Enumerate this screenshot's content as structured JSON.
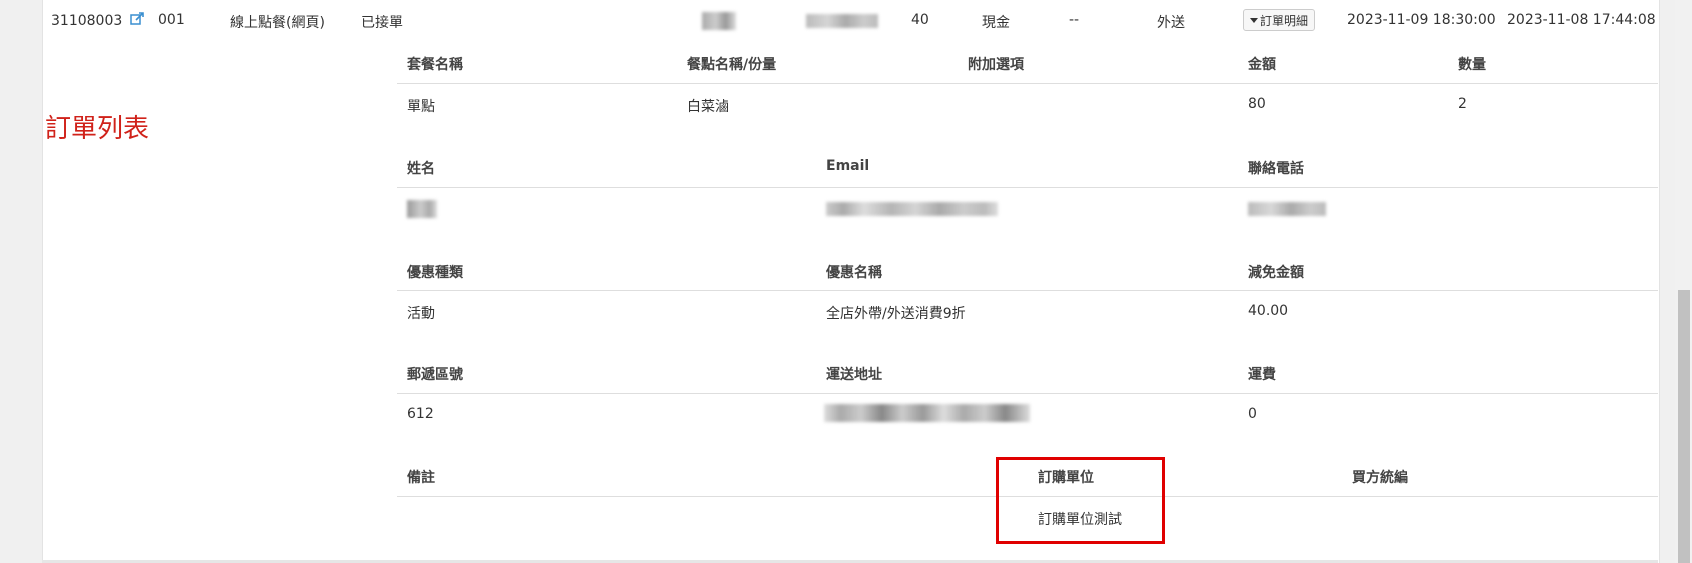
{
  "order_row": {
    "order_no": "31108003",
    "table_no": "001",
    "channel": "線上點餐(網頁)",
    "status": "已接單",
    "amount": "40",
    "payment": "現金",
    "dash": "--",
    "delivery_type": "外送",
    "detail_button": "訂單明細",
    "pickup_time": "2023-11-09 18:30:00",
    "created_time": "2023-11-08 17:44:08"
  },
  "side_title": "訂單列表",
  "items_table": {
    "headers": [
      "套餐名稱",
      "餐點名稱/份量",
      "附加選項",
      "金額",
      "數量"
    ],
    "row": [
      "單點",
      "白菜滷",
      "",
      "80",
      "2"
    ]
  },
  "customer": {
    "headers": [
      "姓名",
      "Email",
      "聯絡電話"
    ]
  },
  "discount": {
    "headers": [
      "優惠種類",
      "優惠名稱",
      "減免金額"
    ],
    "row": [
      "活動",
      "全店外帶/外送消費9折",
      "40.00"
    ]
  },
  "shipping": {
    "headers": [
      "郵遞區號",
      "運送地址",
      "運費"
    ],
    "row": [
      "612",
      "",
      "0"
    ]
  },
  "notes": {
    "headers": [
      "備註",
      "訂購單位",
      "買方統編"
    ],
    "row": [
      "",
      "訂購單位測試",
      ""
    ]
  },
  "colors": {
    "highlight_border": "#e00000",
    "side_title": "#d0221a"
  }
}
